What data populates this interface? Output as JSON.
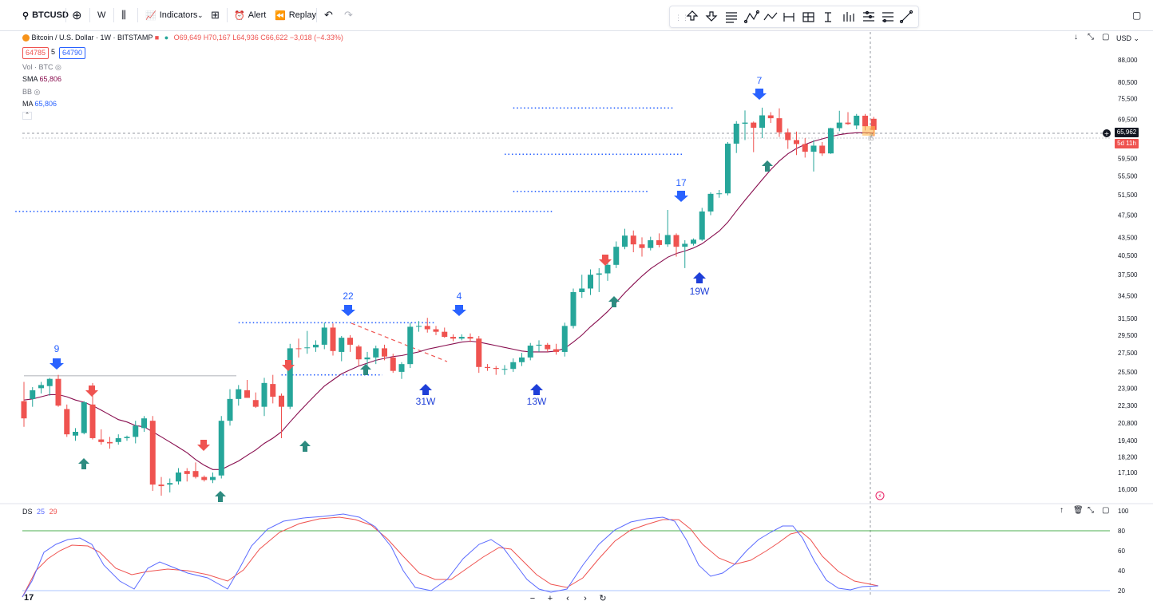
{
  "toolbar": {
    "symbol": "BTCUSD",
    "interval": "W",
    "indicators_label": "Indicators",
    "alert_label": "Alert",
    "replay_label": "Replay"
  },
  "legend": {
    "title": "Bitcoin / U.S. Dollar · 1W · BITSTAMP",
    "open": "O69,649",
    "high": "H70,167",
    "low": "L64,936",
    "close": "C66,622",
    "change": "−3,018 (−4.33%)",
    "bid": "64785",
    "spread": "5",
    "ask": "64790",
    "vol": "Vol · BTC",
    "sma_label": "SMA",
    "sma_value": "65,806",
    "bb_label": "BB",
    "ma_label": "MA",
    "ma_value": "65,806"
  },
  "right_header": {
    "currency": "USD"
  },
  "price_axis": [
    "88,000",
    "80,500",
    "75,500",
    "69,500",
    "59,500",
    "55,500",
    "51,500",
    "47,500",
    "43,500",
    "40,500",
    "37,500",
    "34,500",
    "31,500",
    "29,500",
    "27,500",
    "25,500",
    "23,900",
    "22,300",
    "20,800",
    "19,400",
    "18,200",
    "17,100",
    "16,000"
  ],
  "last_price": {
    "value": "65,962",
    "countdown": "5d 11h"
  },
  "annotations": {
    "top_numbers": [
      "9",
      "22",
      "4",
      "17",
      "7"
    ],
    "week_labels": [
      "31W",
      "13W",
      "19W"
    ]
  },
  "oscillator": {
    "name": "DS",
    "p1": "25",
    "p2": "29",
    "levels": [
      "100",
      "80",
      "60",
      "40",
      "20"
    ]
  },
  "colors": {
    "up": "#26a69a",
    "down": "#ef5350",
    "up_dark": "#2d8b80",
    "arrow_blue": "#2962ff",
    "sma": "#880e4f",
    "osc_fast": "#5b6bff",
    "osc_slow": "#ef5350"
  },
  "chart_data": {
    "type": "candlestick",
    "candles": [
      {
        "o": 21200,
        "h": 24500,
        "l": 20500,
        "c": 22700,
        "d": 0
      },
      {
        "o": 22900,
        "h": 24000,
        "l": 22200,
        "c": 23700,
        "d": 1
      },
      {
        "o": 23900,
        "h": 24500,
        "l": 23400,
        "c": 24200,
        "d": 1
      },
      {
        "o": 24100,
        "h": 24900,
        "l": 23200,
        "c": 24800,
        "d": 1
      },
      {
        "o": 24800,
        "h": 25200,
        "l": 22200,
        "c": 22300,
        "d": 0
      },
      {
        "o": 22000,
        "h": 22400,
        "l": 19700,
        "c": 19900,
        "d": 0
      },
      {
        "o": 19800,
        "h": 20400,
        "l": 19400,
        "c": 20100,
        "d": 1
      },
      {
        "o": 20000,
        "h": 22700,
        "l": 19900,
        "c": 22600,
        "d": 1
      },
      {
        "o": 22400,
        "h": 24400,
        "l": 19500,
        "c": 19600,
        "d": 0
      },
      {
        "o": 19500,
        "h": 20300,
        "l": 19100,
        "c": 19300,
        "d": 0
      },
      {
        "o": 19300,
        "h": 19700,
        "l": 18800,
        "c": 19200,
        "d": 0
      },
      {
        "o": 19300,
        "h": 19900,
        "l": 19100,
        "c": 19600,
        "d": 1
      },
      {
        "o": 19600,
        "h": 19800,
        "l": 19400,
        "c": 19700,
        "d": 1
      },
      {
        "o": 19700,
        "h": 21000,
        "l": 19200,
        "c": 20600,
        "d": 1
      },
      {
        "o": 20400,
        "h": 21400,
        "l": 20100,
        "c": 21200,
        "d": 1
      },
      {
        "o": 21000,
        "h": 21400,
        "l": 15900,
        "c": 16300,
        "d": 0
      },
      {
        "o": 16300,
        "h": 16800,
        "l": 15600,
        "c": 16200,
        "d": 0
      },
      {
        "o": 16300,
        "h": 16700,
        "l": 15800,
        "c": 16400,
        "d": 1
      },
      {
        "o": 16500,
        "h": 17400,
        "l": 16300,
        "c": 17100,
        "d": 1
      },
      {
        "o": 17000,
        "h": 17400,
        "l": 16500,
        "c": 17200,
        "d": 0
      },
      {
        "o": 17200,
        "h": 17800,
        "l": 16700,
        "c": 16800,
        "d": 0
      },
      {
        "o": 16800,
        "h": 16900,
        "l": 16500,
        "c": 16600,
        "d": 0
      },
      {
        "o": 16600,
        "h": 17100,
        "l": 16400,
        "c": 16800,
        "d": 1
      },
      {
        "o": 16900,
        "h": 21400,
        "l": 16700,
        "c": 21000,
        "d": 1
      },
      {
        "o": 21000,
        "h": 23800,
        "l": 20600,
        "c": 22900,
        "d": 1
      },
      {
        "o": 22900,
        "h": 24200,
        "l": 22300,
        "c": 23800,
        "d": 1
      },
      {
        "o": 23700,
        "h": 24700,
        "l": 23300,
        "c": 23000,
        "d": 0
      },
      {
        "o": 22800,
        "h": 23500,
        "l": 22100,
        "c": 22200,
        "d": 0
      },
      {
        "o": 22200,
        "h": 24900,
        "l": 21400,
        "c": 24400,
        "d": 1
      },
      {
        "o": 24300,
        "h": 25200,
        "l": 22500,
        "c": 23100,
        "d": 0
      },
      {
        "o": 23200,
        "h": 23400,
        "l": 19600,
        "c": 22200,
        "d": 0
      },
      {
        "o": 22200,
        "h": 28500,
        "l": 22000,
        "c": 28000,
        "d": 1
      },
      {
        "o": 28000,
        "h": 29100,
        "l": 27000,
        "c": 28000,
        "d": 0
      },
      {
        "o": 28100,
        "h": 30000,
        "l": 27400,
        "c": 28100,
        "d": 1
      },
      {
        "o": 28100,
        "h": 28900,
        "l": 27600,
        "c": 28400,
        "d": 1
      },
      {
        "o": 28400,
        "h": 31000,
        "l": 27900,
        "c": 30400,
        "d": 1
      },
      {
        "o": 30400,
        "h": 30900,
        "l": 27200,
        "c": 27700,
        "d": 0
      },
      {
        "o": 27600,
        "h": 29400,
        "l": 26600,
        "c": 29200,
        "d": 1
      },
      {
        "o": 29200,
        "h": 29500,
        "l": 27600,
        "c": 28400,
        "d": 0
      },
      {
        "o": 28200,
        "h": 28400,
        "l": 26100,
        "c": 26800,
        "d": 0
      },
      {
        "o": 26800,
        "h": 27600,
        "l": 25900,
        "c": 27000,
        "d": 1
      },
      {
        "o": 27000,
        "h": 28300,
        "l": 26300,
        "c": 28000,
        "d": 1
      },
      {
        "o": 28000,
        "h": 28400,
        "l": 26700,
        "c": 27100,
        "d": 0
      },
      {
        "o": 27000,
        "h": 27400,
        "l": 25400,
        "c": 25600,
        "d": 0
      },
      {
        "o": 25500,
        "h": 26500,
        "l": 24800,
        "c": 26300,
        "d": 1
      },
      {
        "o": 26300,
        "h": 31000,
        "l": 25900,
        "c": 30500,
        "d": 1
      },
      {
        "o": 30500,
        "h": 31200,
        "l": 29900,
        "c": 30600,
        "d": 1
      },
      {
        "o": 30600,
        "h": 31600,
        "l": 29800,
        "c": 30200,
        "d": 0
      },
      {
        "o": 30200,
        "h": 30600,
        "l": 29500,
        "c": 29900,
        "d": 0
      },
      {
        "o": 29900,
        "h": 30400,
        "l": 29200,
        "c": 29300,
        "d": 0
      },
      {
        "o": 29300,
        "h": 29600,
        "l": 28800,
        "c": 29100,
        "d": 0
      },
      {
        "o": 29100,
        "h": 29600,
        "l": 28900,
        "c": 29300,
        "d": 1
      },
      {
        "o": 29300,
        "h": 29700,
        "l": 28700,
        "c": 29100,
        "d": 0
      },
      {
        "o": 29100,
        "h": 29400,
        "l": 25400,
        "c": 26000,
        "d": 0
      },
      {
        "o": 26000,
        "h": 26300,
        "l": 25600,
        "c": 25900,
        "d": 0
      },
      {
        "o": 25900,
        "h": 26100,
        "l": 25200,
        "c": 25800,
        "d": 0
      },
      {
        "o": 25800,
        "h": 26200,
        "l": 25200,
        "c": 25800,
        "d": 1
      },
      {
        "o": 25800,
        "h": 26900,
        "l": 25500,
        "c": 26500,
        "d": 1
      },
      {
        "o": 26500,
        "h": 27500,
        "l": 26100,
        "c": 27000,
        "d": 1
      },
      {
        "o": 27000,
        "h": 28600,
        "l": 26700,
        "c": 28300,
        "d": 1
      },
      {
        "o": 28300,
        "h": 28900,
        "l": 27600,
        "c": 28400,
        "d": 1
      },
      {
        "o": 28400,
        "h": 28600,
        "l": 27600,
        "c": 27900,
        "d": 0
      },
      {
        "o": 27900,
        "h": 28500,
        "l": 27300,
        "c": 27600,
        "d": 0
      },
      {
        "o": 27600,
        "h": 31000,
        "l": 27100,
        "c": 30600,
        "d": 1
      },
      {
        "o": 30600,
        "h": 35500,
        "l": 30300,
        "c": 35000,
        "d": 1
      },
      {
        "o": 35000,
        "h": 37500,
        "l": 34200,
        "c": 35500,
        "d": 1
      },
      {
        "o": 35500,
        "h": 38300,
        "l": 34600,
        "c": 37500,
        "d": 1
      },
      {
        "o": 37500,
        "h": 38500,
        "l": 35000,
        "c": 37700,
        "d": 1
      },
      {
        "o": 37700,
        "h": 40000,
        "l": 36600,
        "c": 39000,
        "d": 1
      },
      {
        "o": 39000,
        "h": 42800,
        "l": 38500,
        "c": 41900,
        "d": 1
      },
      {
        "o": 41900,
        "h": 45000,
        "l": 41500,
        "c": 43800,
        "d": 1
      },
      {
        "o": 43800,
        "h": 44700,
        "l": 41000,
        "c": 42300,
        "d": 0
      },
      {
        "o": 42300,
        "h": 43500,
        "l": 40300,
        "c": 41700,
        "d": 0
      },
      {
        "o": 41700,
        "h": 43600,
        "l": 41300,
        "c": 43000,
        "d": 1
      },
      {
        "o": 43000,
        "h": 44200,
        "l": 41800,
        "c": 42200,
        "d": 0
      },
      {
        "o": 42300,
        "h": 48500,
        "l": 41900,
        "c": 43900,
        "d": 1
      },
      {
        "o": 43900,
        "h": 44200,
        "l": 40300,
        "c": 41900,
        "d": 0
      },
      {
        "o": 41900,
        "h": 43000,
        "l": 38500,
        "c": 42400,
        "d": 1
      },
      {
        "o": 42400,
        "h": 43300,
        "l": 42100,
        "c": 43100,
        "d": 1
      },
      {
        "o": 43100,
        "h": 48900,
        "l": 42900,
        "c": 48200,
        "d": 1
      },
      {
        "o": 48200,
        "h": 52000,
        "l": 47500,
        "c": 51700,
        "d": 1
      },
      {
        "o": 51700,
        "h": 52500,
        "l": 50900,
        "c": 51800,
        "d": 1
      },
      {
        "o": 51800,
        "h": 63500,
        "l": 51400,
        "c": 63100,
        "d": 1
      },
      {
        "o": 63100,
        "h": 69000,
        "l": 60800,
        "c": 68300,
        "d": 1
      },
      {
        "o": 68300,
        "h": 72000,
        "l": 64000,
        "c": 68600,
        "d": 1
      },
      {
        "o": 68600,
        "h": 68900,
        "l": 61000,
        "c": 67200,
        "d": 0
      },
      {
        "o": 67200,
        "h": 72800,
        "l": 64500,
        "c": 70600,
        "d": 1
      },
      {
        "o": 70600,
        "h": 71500,
        "l": 68500,
        "c": 69800,
        "d": 0
      },
      {
        "o": 69800,
        "h": 72600,
        "l": 64800,
        "c": 66000,
        "d": 0
      },
      {
        "o": 66000,
        "h": 67000,
        "l": 61800,
        "c": 64000,
        "d": 0
      },
      {
        "o": 64000,
        "h": 66200,
        "l": 60300,
        "c": 63000,
        "d": 0
      },
      {
        "o": 63000,
        "h": 64500,
        "l": 59700,
        "c": 61100,
        "d": 0
      },
      {
        "o": 61100,
        "h": 64000,
        "l": 56500,
        "c": 62600,
        "d": 1
      },
      {
        "o": 62600,
        "h": 63500,
        "l": 60100,
        "c": 60700,
        "d": 0
      },
      {
        "o": 60700,
        "h": 67200,
        "l": 60600,
        "c": 67100,
        "d": 1
      },
      {
        "o": 67100,
        "h": 71900,
        "l": 66300,
        "c": 68600,
        "d": 1
      },
      {
        "o": 68600,
        "h": 71500,
        "l": 68000,
        "c": 68200,
        "d": 0
      },
      {
        "o": 67800,
        "h": 71000,
        "l": 66800,
        "c": 70500,
        "d": 1
      },
      {
        "o": 70500,
        "h": 71000,
        "l": 66500,
        "c": 67600,
        "d": 0
      },
      {
        "o": 69649,
        "h": 70167,
        "l": 64936,
        "c": 66622,
        "d": 0
      }
    ],
    "sma": [
      22800,
      22900,
      23100,
      23300,
      23300,
      23100,
      22800,
      22600,
      22300,
      21900,
      21500,
      21100,
      20900,
      20600,
      20500,
      20100,
      19700,
      19300,
      18900,
      18500,
      18000,
      17600,
      17300,
      17300,
      17600,
      17900,
      18300,
      18700,
      19200,
      19600,
      20100,
      20900,
      21700,
      22500,
      23300,
      24100,
      24700,
      25300,
      25700,
      26100,
      26400,
      26700,
      26900,
      27100,
      27200,
      27400,
      27600,
      27900,
      28100,
      28300,
      28500,
      28700,
      28800,
      28700,
      28500,
      28300,
      28100,
      27900,
      27700,
      27600,
      27600,
      27600,
      27700,
      28000,
      28700,
      29500,
      30500,
      31400,
      32400,
      33600,
      34900,
      36100,
      37300,
      38400,
      39300,
      40200,
      40800,
      41200,
      41700,
      42400,
      43500,
      44600,
      46200,
      48300,
      50400,
      52500,
      54700,
      56900,
      58900,
      60600,
      61900,
      62900,
      63700,
      64300,
      64900,
      65400,
      65700,
      65900,
      65900,
      65806
    ],
    "hlines": [
      {
        "price": 25100,
        "from": 0,
        "to": 24,
        "style": "solid",
        "color": "#9598a1"
      },
      {
        "price": 31000,
        "from": 25,
        "to": 47,
        "style": "dotted",
        "color": "#2962ff"
      },
      {
        "price": 25200,
        "from": 30,
        "to": 41,
        "style": "dotted",
        "color": "#2962ff"
      },
      {
        "price": 48200,
        "from": -1,
        "to": 61,
        "style": "dotted",
        "color": "#2962ff"
      },
      {
        "price": 52200,
        "from": 57,
        "to": 72,
        "style": "dotted",
        "color": "#2962ff"
      },
      {
        "price": 60500,
        "from": 56,
        "to": 76,
        "style": "dotted",
        "color": "#2962ff"
      },
      {
        "price": 72700,
        "from": 57,
        "to": 75,
        "style": "dotted",
        "color": "#2962ff"
      }
    ]
  }
}
